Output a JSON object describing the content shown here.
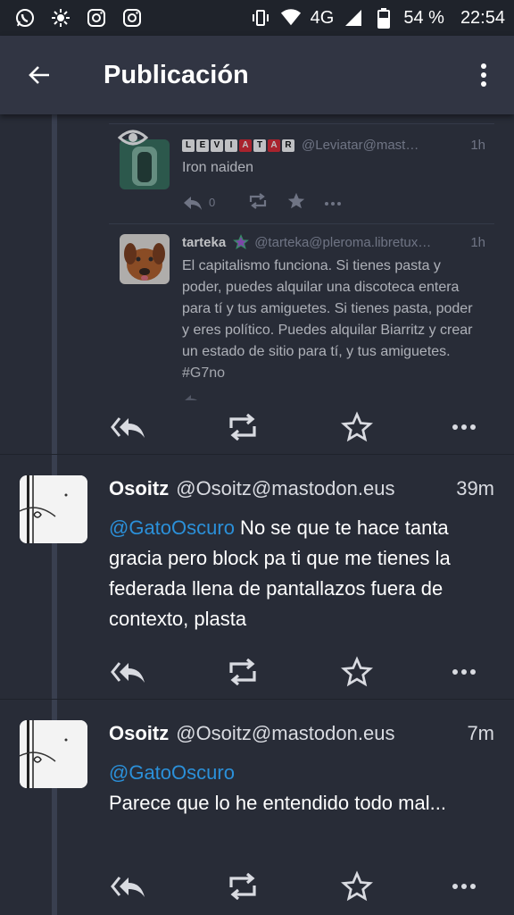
{
  "status_bar": {
    "battery": "54 %",
    "time": "22:54",
    "network": "4G",
    "left_icons": [
      "whatsapp-icon",
      "settings-sun-icon",
      "instagram-icon",
      "instagram-icon"
    ],
    "right_icons": [
      "vibrate-icon",
      "wifi-icon",
      "signal-icon",
      "battery-icon"
    ]
  },
  "appbar": {
    "title": "Publicación",
    "background": "#313543"
  },
  "nested_posts": [
    {
      "name_letters": [
        "L",
        "E",
        "V",
        "I",
        "A",
        "T",
        "A",
        "R"
      ],
      "name_red_letters": [
        4,
        6
      ],
      "handle": "@Leviatar@mast…",
      "time": "1h",
      "body": "Iron naiden",
      "reply_count": "0"
    },
    {
      "name": "tarteka",
      "handle": "@tarteka@pleroma.libretux…",
      "time": "1h",
      "body": "El capitalismo funciona. Si tienes pasta y poder, puedes alquilar una discoteca entera para tí y tus amiguetes. Si tienes pasta, poder y eres político. Puedes alquilar Biarritz y crear un estado de sitio para tí, y tus amiguetes.",
      "hashtag": "#G7no"
    }
  ],
  "posts": [
    {
      "name": "Osoitz",
      "handle": "@Osoitz@mastodon.eus",
      "time": "39m",
      "mention": "@GatoOscuro",
      "body": " No se que te hace tanta gracia pero block pa ti que me tienes la federada llena de pantallazos fuera de contexto, plasta"
    },
    {
      "name": "Osoitz",
      "handle": "@Osoitz@mastodon.eus",
      "time": "7m",
      "mention": "@GatoOscuro",
      "body": "Parece que lo he entendido todo mal..."
    }
  ],
  "colors": {
    "background": "#282c37",
    "mention": "#2b90d9",
    "muted": "#8d93a5"
  }
}
